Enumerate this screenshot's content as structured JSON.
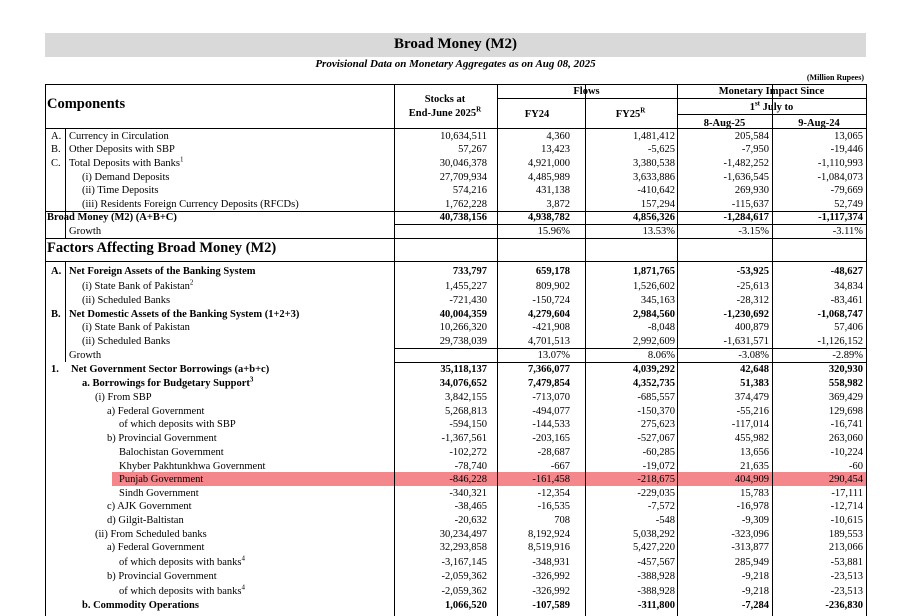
{
  "title": "Broad Money (M2)",
  "subtitle": "Provisional Data on Monetary Aggregates as on Aug 08, 2025",
  "units": "(Million Rupees)",
  "header": {
    "components": "Components",
    "stocks_line1": "Stocks at",
    "stocks_line2": "End-June 2025",
    "stocks_sup": "R",
    "flows": "Flows",
    "fy24": "FY24",
    "fy25": "FY25",
    "fy25_sup": "R",
    "impact": "Monetary Impact Since",
    "impact_sub_pre": "1",
    "impact_sub_sup": "st",
    "impact_sub_post": " July to",
    "d1": "8-Aug-25",
    "d2": "9-Aug-24"
  },
  "components_rows": [
    {
      "key": "A.",
      "label": "Currency in Circulation",
      "sup": "",
      "v": [
        "10,634,511",
        "4,360",
        "1,481,412",
        "205,584",
        "13,065"
      ]
    },
    {
      "key": "B.",
      "label": "Other Deposits with SBP",
      "sup": "",
      "v": [
        "57,267",
        "13,423",
        "-5,625",
        "-7,950",
        "-19,446"
      ]
    },
    {
      "key": "C.",
      "label": "Total Deposits with Banks",
      "sup": "1",
      "v": [
        "30,046,378",
        "4,921,000",
        "3,380,538",
        "-1,482,252",
        "-1,110,993"
      ]
    },
    {
      "key": "",
      "label": "(i) Demand Deposits",
      "sup": "",
      "v": [
        "27,709,934",
        "4,485,989",
        "3,633,886",
        "-1,636,545",
        "-1,084,073"
      ]
    },
    {
      "key": "",
      "label": "(ii) Time Deposits",
      "sup": "",
      "v": [
        "574,216",
        "431,138",
        "-410,642",
        "269,930",
        "-79,669"
      ]
    },
    {
      "key": "",
      "label": "(iii) Residents Foreign Currency Deposits (RFCDs)",
      "sup": "",
      "v": [
        "1,762,228",
        "3,872",
        "157,294",
        "-115,637",
        "52,749"
      ]
    }
  ],
  "broad_money": {
    "label": "Broad Money (M2) (A+B+C)",
    "v": [
      "40,738,156",
      "4,938,782",
      "4,856,326",
      "-1,284,617",
      "-1,117,374"
    ]
  },
  "growth1": {
    "label": "Growth",
    "v": [
      "",
      "15.96%",
      "13.53%",
      "-3.15%",
      "-3.11%"
    ]
  },
  "factors_title": "Factors Affecting Broad Money (M2)",
  "factor_rows": [
    {
      "key": "A.",
      "label": "Net Foreign Assets of the Banking System",
      "sup": "",
      "bold": true,
      "v": [
        "733,797",
        "659,178",
        "1,871,765",
        "-53,925",
        "-48,627"
      ]
    },
    {
      "key": "",
      "label": "(i) State Bank of Pakistan",
      "sup": "2",
      "bold": false,
      "v": [
        "1,455,227",
        "809,902",
        "1,526,602",
        "-25,613",
        "34,834"
      ]
    },
    {
      "key": "",
      "label": "(ii) Scheduled Banks",
      "sup": "",
      "bold": false,
      "v": [
        "-721,430",
        "-150,724",
        "345,163",
        "-28,312",
        "-83,461"
      ]
    },
    {
      "key": "B.",
      "label": "Net Domestic Assets of the Banking System (1+2+3)",
      "sup": "",
      "bold": true,
      "v": [
        "40,004,359",
        "4,279,604",
        "2,984,560",
        "-1,230,692",
        "-1,068,747"
      ]
    },
    {
      "key": "",
      "label": "(i) State Bank of Pakistan",
      "sup": "",
      "bold": false,
      "v": [
        "10,266,320",
        "-421,908",
        "-8,048",
        "400,879",
        "57,406"
      ]
    },
    {
      "key": "",
      "label": "(ii) Scheduled Banks",
      "sup": "",
      "bold": false,
      "v": [
        "29,738,039",
        "4,701,513",
        "2,992,609",
        "-1,631,571",
        "-1,126,152"
      ]
    },
    {
      "key": "",
      "label": "Growth",
      "sup": "",
      "bold": false,
      "v": [
        "",
        "13.07%",
        "8.06%",
        "-3.08%",
        "-2.89%"
      ]
    },
    {
      "key": "1.",
      "label": "Net Government Sector Borrowings (a+b+c)",
      "sup": "",
      "bold": true,
      "v": [
        "35,118,137",
        "7,366,077",
        "4,039,292",
        "42,648",
        "320,930"
      ]
    },
    {
      "key": "",
      "label": "a. Borrowings for Budgetary Support",
      "sup": "3",
      "bold": true,
      "v": [
        "34,076,652",
        "7,479,854",
        "4,352,735",
        "51,383",
        "558,982"
      ]
    },
    {
      "key": "",
      "label": "(i) From SBP",
      "sup": "",
      "bold": false,
      "v": [
        "3,842,155",
        "-713,070",
        "-685,557",
        "374,479",
        "369,429"
      ]
    },
    {
      "key": "",
      "label": "a) Federal Government",
      "sup": "",
      "bold": false,
      "v": [
        "5,268,813",
        "-494,077",
        "-150,370",
        "-55,216",
        "129,698"
      ]
    },
    {
      "key": "",
      "label": "of which deposits with SBP",
      "sup": "",
      "bold": false,
      "v": [
        "-594,150",
        "-144,533",
        "275,623",
        "-117,014",
        "-16,741"
      ]
    },
    {
      "key": "",
      "label": "b) Provincial Government",
      "sup": "",
      "bold": false,
      "v": [
        "-1,367,561",
        "-203,165",
        "-527,067",
        "455,982",
        "263,060"
      ]
    },
    {
      "key": "",
      "label": "Balochistan Government",
      "sup": "",
      "bold": false,
      "v": [
        "-102,272",
        "-28,687",
        "-60,285",
        "13,656",
        "-10,224"
      ]
    },
    {
      "key": "",
      "label": "Khyber Pakhtunkhwa Government",
      "sup": "",
      "bold": false,
      "v": [
        "-78,740",
        "-667",
        "-19,072",
        "21,635",
        "-60"
      ]
    },
    {
      "key": "",
      "label": "Punjab Government",
      "sup": "",
      "bold": false,
      "v": [
        "-846,228",
        "-161,458",
        "-218,675",
        "404,909",
        "290,454"
      ]
    },
    {
      "key": "",
      "label": "Sindh Government",
      "sup": "",
      "bold": false,
      "v": [
        "-340,321",
        "-12,354",
        "-229,035",
        "15,783",
        "-17,111"
      ]
    },
    {
      "key": "",
      "label": "c) AJK Government",
      "sup": "",
      "bold": false,
      "v": [
        "-38,465",
        "-16,535",
        "-7,572",
        "-16,978",
        "-12,714"
      ]
    },
    {
      "key": "",
      "label": "d) Gilgit-Baltistan",
      "sup": "",
      "bold": false,
      "v": [
        "-20,632",
        "708",
        "-548",
        "-9,309",
        "-10,615"
      ]
    },
    {
      "key": "",
      "label": "(ii) From Scheduled banks",
      "sup": "",
      "bold": false,
      "v": [
        "30,234,497",
        "8,192,924",
        "5,038,292",
        "-323,096",
        "189,553"
      ]
    },
    {
      "key": "",
      "label": "a) Federal Government",
      "sup": "",
      "bold": false,
      "v": [
        "32,293,858",
        "8,519,916",
        "5,427,220",
        "-313,877",
        "213,066"
      ]
    },
    {
      "key": "",
      "label": "of which deposits with banks",
      "sup": "4",
      "bold": false,
      "v": [
        "-3,167,145",
        "-348,931",
        "-457,567",
        "285,949",
        "-53,881"
      ]
    },
    {
      "key": "",
      "label": "b) Provincial Government",
      "sup": "",
      "bold": false,
      "v": [
        "-2,059,362",
        "-326,992",
        "-388,928",
        "-9,218",
        "-23,513"
      ]
    },
    {
      "key": "",
      "label": "of which deposits with banks",
      "sup": "4",
      "bold": false,
      "v": [
        "-2,059,362",
        "-326,992",
        "-388,928",
        "-9,218",
        "-23,513"
      ]
    },
    {
      "key": "",
      "label": "b. Commodity Operations",
      "sup": "",
      "bold": true,
      "v": [
        "1,066,520",
        "-107,589",
        "-311,800",
        "-7,284",
        "-236,830"
      ]
    }
  ]
}
